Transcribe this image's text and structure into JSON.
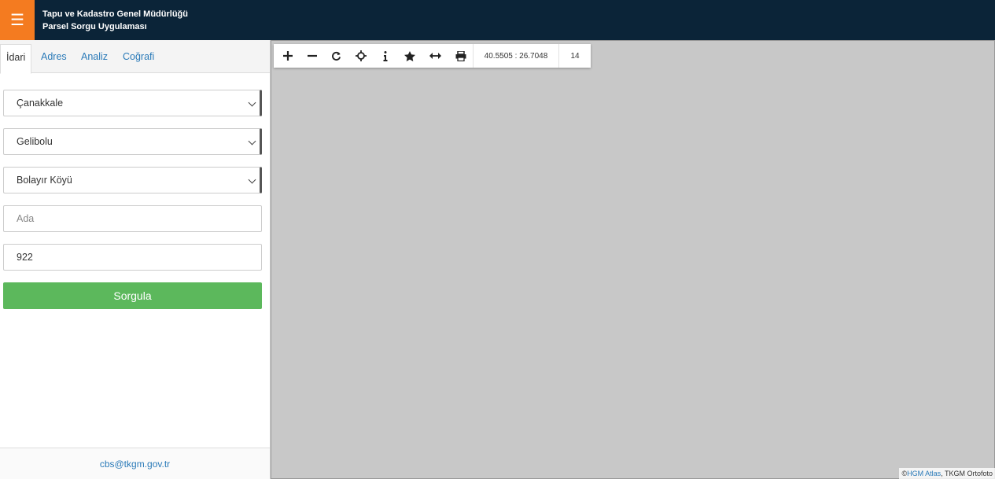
{
  "header": {
    "menu_icon": "hamburger-icon",
    "title_line1": "Tapu ve Kadastro Genel Müdürlüğü",
    "title_line2": "Parsel Sorgu Uygulaması"
  },
  "tabs": [
    {
      "label": "İdari"
    },
    {
      "label": "Adres"
    },
    {
      "label": "Analiz"
    },
    {
      "label": "Coğrafi"
    }
  ],
  "form": {
    "il": "Çanakkale",
    "ilce": "Gelibolu",
    "mahalle": "Bolayır Köyü",
    "ada_placeholder": "Ada",
    "parsel": "922",
    "submit_label": "Sorgula"
  },
  "footer": {
    "email": "cbs@tkgm.gov.tr"
  },
  "toolbar": {
    "coordinates": "40.5505 : 26.7048",
    "zoom": "14",
    "icons": [
      "zoom-in-icon",
      "zoom-out-icon",
      "refresh-icon",
      "locate-icon",
      "info-icon",
      "favorite-icon",
      "measure-icon",
      "print-icon"
    ]
  },
  "attribution": {
    "prefix": "© ",
    "link": "HGM Atlas",
    "suffix": ", TKGM Ortofoto"
  },
  "colors": {
    "header": "#0b2438",
    "menu": "#f47b20",
    "submit": "#5cb85c",
    "link": "#2a7ab8"
  }
}
